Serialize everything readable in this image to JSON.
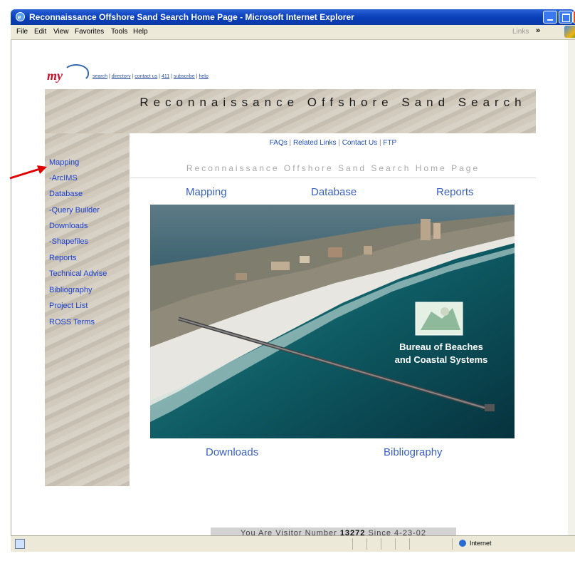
{
  "window": {
    "title": "Reconnaissance Offshore Sand Search Home Page - Microsoft Internet Explorer",
    "menu": [
      "File",
      "Edit",
      "View",
      "Favorites",
      "Tools",
      "Help"
    ],
    "links_label": "Links",
    "links_chevron": "»"
  },
  "status_bar": {
    "zone": "Internet"
  },
  "logo": {
    "text": "my"
  },
  "top_links": [
    "search",
    "directory",
    "contact us",
    "411",
    "subscribe",
    "help"
  ],
  "header": {
    "title": "Reconnaissance Offshore Sand Search"
  },
  "subnav": [
    "FAQs",
    "Related Links",
    "Contact Us",
    "FTP"
  ],
  "sidebar": {
    "items": [
      "Mapping",
      "-ArcIMS",
      "Database",
      "-Query Builder",
      "Downloads",
      "-Shapefiles",
      "Reports",
      "Technical Advise",
      "Bibliography",
      "Project List",
      "ROSS Terms"
    ]
  },
  "page_heading": "Reconnaissance Offshore Sand Search Home Page",
  "main_links": {
    "mapping": "Mapping",
    "database": "Database",
    "reports": "Reports",
    "downloads": "Downloads",
    "bibliography": "Bibliography"
  },
  "photo": {
    "bureau_line1": "Bureau of Beaches",
    "bureau_line2": "and Coastal Systems"
  },
  "visitor": {
    "prefix": "You Are Visitor Number",
    "count": "13272",
    "suffix": "Since 4-23-02"
  },
  "colors": {
    "titlebar": "#0a3fb8",
    "nav_link": "#1a3fd0",
    "arrow": "#e00000",
    "sand": "#cfc7b9"
  }
}
